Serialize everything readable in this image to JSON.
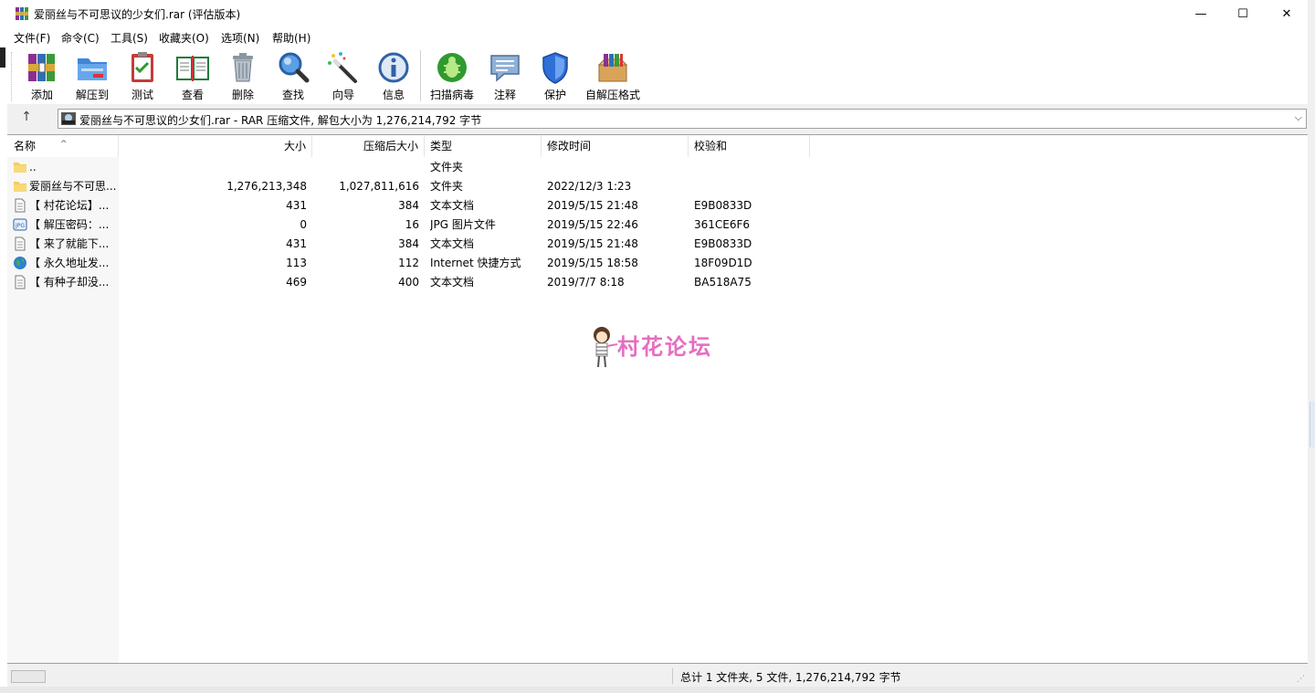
{
  "window": {
    "title": "爱丽丝与不可思议的少女们.rar (评估版本)",
    "controls": {
      "minimize": "—",
      "maximize": "☐",
      "close": "✕"
    }
  },
  "menu": [
    "文件(F)",
    "命令(C)",
    "工具(S)",
    "收藏夹(O)",
    "选项(N)",
    "帮助(H)"
  ],
  "toolbar": {
    "add": "添加",
    "extract": "解压到",
    "test": "测试",
    "view": "查看",
    "delete": "删除",
    "find": "查找",
    "wizard": "向导",
    "info": "信息",
    "scan": "扫描病毒",
    "comment": "注释",
    "protect": "保护",
    "sfx": "自解压格式"
  },
  "address": {
    "text": "爱丽丝与不可思议的少女们.rar - RAR 压缩文件, 解包大小为 1,276,214,792 字节",
    "up_arrow": "↑",
    "dropdown": "⌵"
  },
  "columns": {
    "name": "名称",
    "size": "大小",
    "packed": "压缩后大小",
    "type": "类型",
    "mtime": "修改时间",
    "crc": "校验和",
    "sort_indicator": "^"
  },
  "rows": [
    {
      "name": "..",
      "size": "",
      "packed": "",
      "type": "文件夹",
      "mtime": "",
      "crc": "",
      "icon": "folder-icon"
    },
    {
      "name": "爱丽丝与不可思...",
      "size": "1,276,213,348",
      "packed": "1,027,811,616",
      "type": "文件夹",
      "mtime": "2022/12/3 1:23",
      "crc": "",
      "icon": "folder-icon"
    },
    {
      "name": "【 村花论坛】...",
      "size": "431",
      "packed": "384",
      "type": "文本文档",
      "mtime": "2019/5/15 21:48",
      "crc": "E9B0833D",
      "icon": "text-file-icon"
    },
    {
      "name": "【 解压密码：...",
      "size": "0",
      "packed": "16",
      "type": "JPG 图片文件",
      "mtime": "2019/5/15 22:46",
      "crc": "361CE6F6",
      "icon": "jpg-file-icon"
    },
    {
      "name": "【 来了就能下...",
      "size": "431",
      "packed": "384",
      "type": "文本文档",
      "mtime": "2019/5/15 21:48",
      "crc": "E9B0833D",
      "icon": "text-file-icon"
    },
    {
      "name": "【 永久地址发...",
      "size": "113",
      "packed": "112",
      "type": "Internet 快捷方式",
      "mtime": "2019/5/15 18:58",
      "crc": "18F09D1D",
      "icon": "globe-icon"
    },
    {
      "name": "【 有种子却没...",
      "size": "469",
      "packed": "400",
      "type": "文本文档",
      "mtime": "2019/7/7 8:18",
      "crc": "BA518A75",
      "icon": "text-file-icon"
    }
  ],
  "watermark": {
    "text": "村花论坛"
  },
  "status": {
    "text": "总计 1 文件夹, 5 文件, 1,276,214,792 字节"
  },
  "colors": {
    "watermark": "#e66ec0",
    "window_bg": "#f0f0f0",
    "list_bg": "#ffffff"
  }
}
